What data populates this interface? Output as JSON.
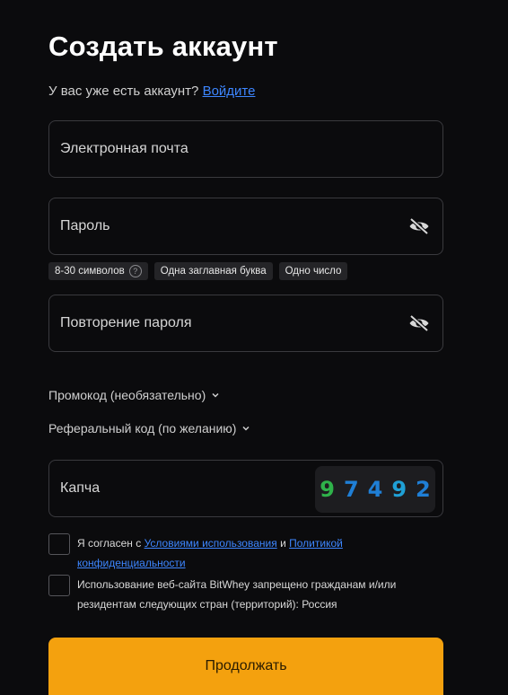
{
  "header": {
    "title": "Создать аккаунт",
    "have_account": "У вас уже есть аккаунт?",
    "login_link": "Войдите"
  },
  "form": {
    "email_label": "Электронная почта",
    "password_label": "Пароль",
    "repeat_password_label": "Повторение пароля",
    "password_hints": [
      "8-30 символов",
      "Одна заглавная буква",
      "Одно число"
    ],
    "hint_help_icon": "?",
    "promo_label": "Промокод (необязательно)",
    "referral_label": "Реферальный код (по желанию)",
    "captcha_label": "Капча",
    "captcha_digits": [
      {
        "digit": "9",
        "color": "#2fb24a"
      },
      {
        "digit": "7",
        "color": "#1f7fd6"
      },
      {
        "digit": "4",
        "color": "#1f7fd6"
      },
      {
        "digit": "9",
        "color": "#1fa0d6"
      },
      {
        "digit": "2",
        "color": "#1f7fd6"
      }
    ]
  },
  "agreements": {
    "terms_prefix": "Я согласен с",
    "terms_link": "Условиями использования",
    "terms_and": "и",
    "policy_link_1": "Политикой",
    "policy_link_2": "конфиденциальности",
    "restriction_line1": "Использование веб-сайта BitWhey запрещено гражданам и/или",
    "restriction_line2": "резидентам следующих стран (территорий): Россия"
  },
  "submit_label": "Продолжать",
  "colors": {
    "background": "#0b0b0d",
    "accent": "#f4a10e",
    "link": "#3d86ff",
    "field_border": "#3a3a3e"
  },
  "icons": {
    "password_toggle": "eye-off-icon",
    "dropdown": "chevron-down-icon",
    "hint_help": "question-circle-icon"
  }
}
